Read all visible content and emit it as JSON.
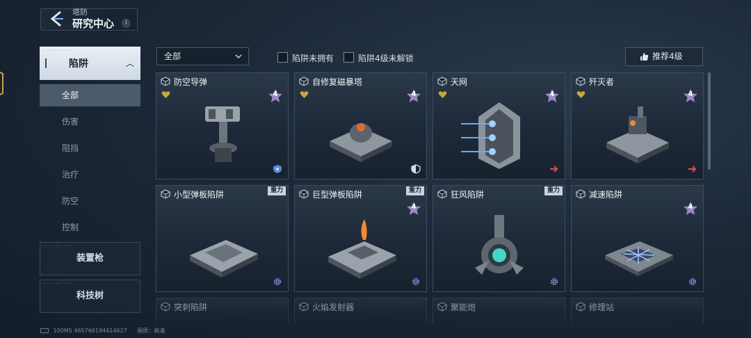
{
  "header": {
    "subtitle": "塔防",
    "title": "研究中心",
    "info": "i"
  },
  "sidebar": {
    "active_category": {
      "label": "陷阱",
      "tiny_text": "- -- -- -  --- -"
    },
    "sub_items": [
      "全部",
      "伤害",
      "阻挡",
      "治疗",
      "防空",
      "控制"
    ],
    "categories": [
      {
        "label": "装置枪",
        "tiny_text": "-- -- --- -- -"
      },
      {
        "label": "科技树",
        "tiny_text": "-- -- --- -- -"
      }
    ]
  },
  "filters": {
    "dropdown_value": "全部",
    "checkbox1_label": "陷阱未拥有",
    "checkbox2_label": "陷阱4级未解锁",
    "recommend_label": "推荐4级"
  },
  "cards": [
    {
      "name": "防空导弹",
      "level": "4",
      "favorite": true,
      "corner": "shield-icon",
      "tag": ""
    },
    {
      "name": "自修复磁暴塔",
      "level": "4",
      "favorite": true,
      "corner": "half-shield-icon",
      "tag": ""
    },
    {
      "name": "天网",
      "level": "4",
      "favorite": true,
      "corner": "arrow-icon",
      "tag": ""
    },
    {
      "name": "歼灭者",
      "level": "4",
      "favorite": true,
      "corner": "arrow-icon",
      "tag": ""
    },
    {
      "name": "小型弹板陷阱",
      "level": "",
      "favorite": false,
      "corner": "gear-icon",
      "tag": "重力"
    },
    {
      "name": "巨型弹板陷阱",
      "level": "4",
      "favorite": false,
      "corner": "gear-icon",
      "tag": "重力"
    },
    {
      "name": "狂风陷阱",
      "level": "",
      "favorite": false,
      "corner": "gear-icon",
      "tag": "重力"
    },
    {
      "name": "减速陷阱",
      "level": "4",
      "favorite": false,
      "corner": "gear-icon",
      "tag": ""
    },
    {
      "name": "突刺陷阱",
      "level": "",
      "favorite": false,
      "corner": "",
      "tag": ""
    },
    {
      "name": "火焰发射器",
      "level": "",
      "favorite": false,
      "corner": "",
      "tag": ""
    },
    {
      "name": "聚能炮",
      "level": "",
      "favorite": false,
      "corner": "",
      "tag": ""
    },
    {
      "name": "修理站",
      "level": "",
      "favorite": false,
      "corner": "",
      "tag": ""
    }
  ],
  "footer": {
    "status": "100MS  465766194414627",
    "quality": "画质：高清"
  },
  "colors": {
    "favorite": "#c9a53c",
    "level_badge": "#9b8ac9",
    "arrow": "#e0524f",
    "gear": "#8f86d9",
    "shield": "#5b8ed8"
  }
}
